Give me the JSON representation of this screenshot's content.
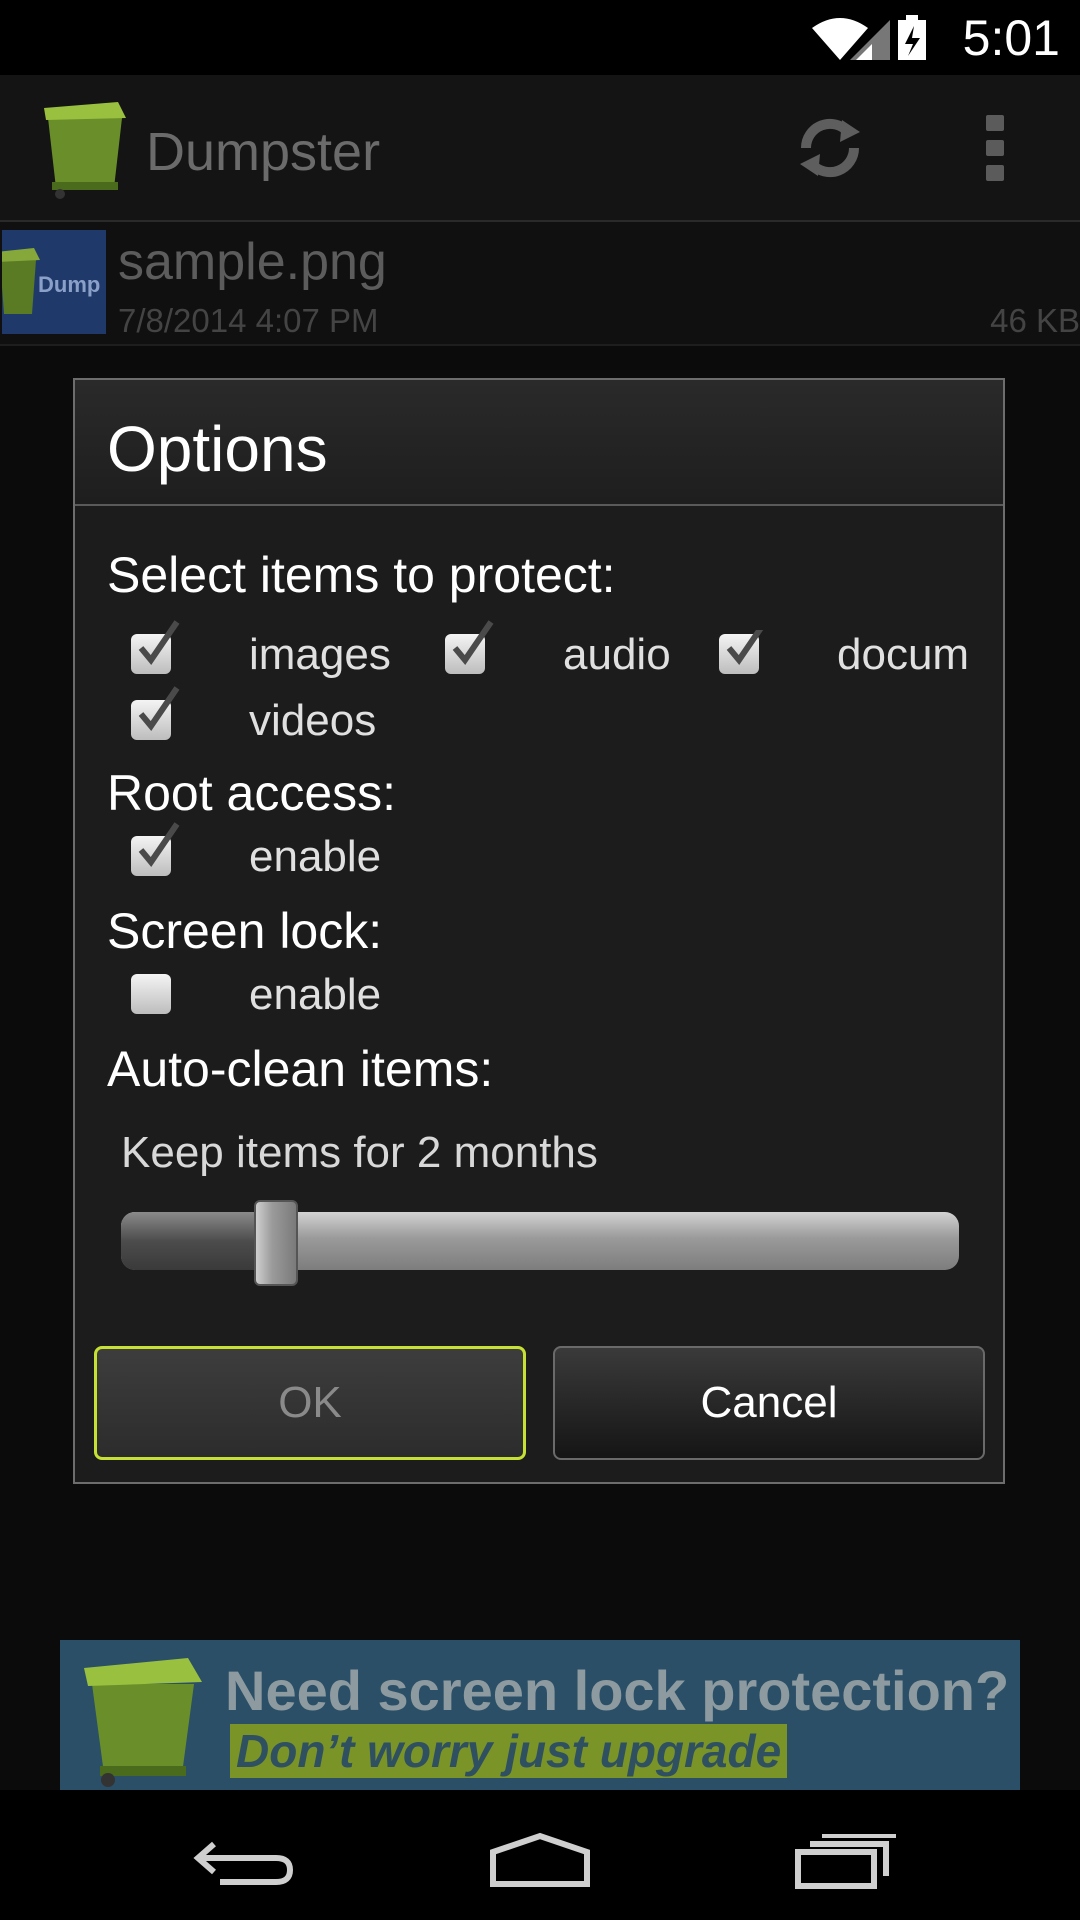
{
  "status_bar": {
    "time": "5:01"
  },
  "action_bar": {
    "title": "Dumpster"
  },
  "file_row": {
    "thumb_text": "Dump",
    "name": "sample.png",
    "date": "7/8/2014 4:07 PM",
    "size": "46 KB"
  },
  "dialog": {
    "title": "Options",
    "protect_label": "Select items to protect:",
    "protect_items": [
      {
        "label": "images",
        "checked": true
      },
      {
        "label": "audio",
        "checked": true
      },
      {
        "label": "docum",
        "checked": true
      },
      {
        "label": "videos",
        "checked": true
      }
    ],
    "root_label": "Root access:",
    "root_option": {
      "label": "enable",
      "checked": true
    },
    "screen_lock_label": "Screen lock:",
    "screen_lock_option": {
      "label": "enable",
      "checked": false
    },
    "autoclean_label": "Auto-clean items:",
    "keep_text": "Keep items for 2 months",
    "slider_level": 0.185,
    "ok_label": "OK",
    "cancel_label": "Cancel"
  },
  "ad": {
    "line1": "Need screen lock protection?",
    "line2": "Don’t worry just upgrade"
  },
  "colors": {
    "ok_border": "#c6e034",
    "ad_bg": "#2a4f66",
    "dumpster_green": "#6a8f2a"
  }
}
